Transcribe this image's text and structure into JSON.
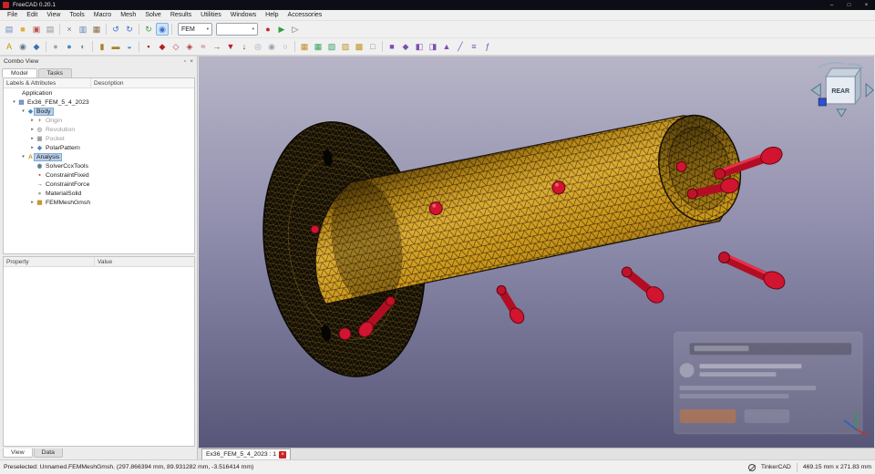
{
  "window": {
    "title": "FreeCAD 0.20.1",
    "minimize": "–",
    "maximize": "□",
    "close": "×"
  },
  "menu_bar": {
    "items": [
      "File",
      "Edit",
      "View",
      "Tools",
      "Macro",
      "Mesh",
      "Solve",
      "Results",
      "Utilities",
      "Windows",
      "Help",
      "Accessories"
    ]
  },
  "toolbars": {
    "workbench_selector": "FEM",
    "macro_selector": "",
    "caret": "▾",
    "row1a": [
      {
        "name": "file-new-icon",
        "glyph": "▤",
        "color": "#6a8cbf",
        "cls": "",
        "inter": "true"
      },
      {
        "name": "file-open-icon",
        "glyph": "■",
        "color": "#e2af3a",
        "cls": "",
        "inter": "true"
      },
      {
        "name": "file-save-icon",
        "glyph": "▣",
        "color": "#c05050",
        "cls": "",
        "inter": "true"
      },
      {
        "name": "print-icon",
        "glyph": "▤",
        "color": "#8a8f99",
        "cls": "",
        "inter": "true"
      },
      {
        "name": "toolbar-separator",
        "glyph": "",
        "color": "",
        "cls": "sep",
        "inter": "false"
      },
      {
        "name": "cut-icon",
        "glyph": "×",
        "color": "#6a7c8e",
        "cls": "",
        "inter": "true"
      },
      {
        "name": "copy-icon",
        "glyph": "▥",
        "color": "#5b82b5",
        "cls": "",
        "inter": "true"
      },
      {
        "name": "paste-icon",
        "glyph": "▦",
        "color": "#8a6a4a",
        "cls": "",
        "inter": "true"
      },
      {
        "name": "toolbar-separator",
        "glyph": "",
        "color": "",
        "cls": "sep",
        "inter": "false"
      },
      {
        "name": "undo-icon",
        "glyph": "↺",
        "color": "#3a6fc0",
        "cls": "",
        "inter": "true"
      },
      {
        "name": "redo-icon",
        "glyph": "↻",
        "color": "#3a6fc0",
        "cls": "",
        "inter": "true"
      },
      {
        "name": "toolbar-separator",
        "glyph": "",
        "color": "",
        "cls": "sep",
        "inter": "false"
      },
      {
        "name": "refresh-icon",
        "glyph": "↻",
        "color": "#3fa040",
        "cls": "",
        "inter": "true"
      },
      {
        "name": "box-zoom-icon",
        "glyph": "◉",
        "color": "#3a6fc0",
        "cls": "active",
        "inter": "true"
      },
      {
        "name": "toolbar-separator",
        "glyph": "",
        "color": "",
        "cls": "sep",
        "inter": "false"
      }
    ],
    "row1b": [
      {
        "name": "macro-record-icon",
        "glyph": "●",
        "color": "#cc2020",
        "cls": "",
        "inter": "true"
      },
      {
        "name": "macro-play-icon",
        "glyph": "▶",
        "color": "#2f9e44",
        "cls": "",
        "inter": "true"
      },
      {
        "name": "macro-debug-icon",
        "glyph": "▷",
        "color": "#5a6b7c",
        "cls": "",
        "inter": "true"
      }
    ],
    "row2": [
      {
        "name": "fem-analysis-icon",
        "glyph": "A",
        "color": "#c8900f",
        "cls": "",
        "inter": "true"
      },
      {
        "name": "fem-solver-ccxtools-icon",
        "glyph": "◉",
        "color": "#5b7a93",
        "cls": "",
        "inter": "true"
      },
      {
        "name": "fem-solver-elmer-icon",
        "glyph": "◆",
        "color": "#3f6fae",
        "cls": "",
        "inter": "true"
      },
      {
        "name": "toolbar-separator",
        "glyph": "",
        "color": "",
        "cls": "sep",
        "inter": "false"
      },
      {
        "name": "fem-material-solid-icon",
        "glyph": "●",
        "color": "#98a6b4",
        "cls": "",
        "inter": "true"
      },
      {
        "name": "fem-material-fluid-icon",
        "glyph": "●",
        "color": "#3f87c0",
        "cls": "",
        "inter": "true"
      },
      {
        "name": "fem-material-editor-icon",
        "glyph": "◐",
        "color": "#7a8a98",
        "cls": "",
        "inter": "true"
      },
      {
        "name": "toolbar-separator",
        "glyph": "",
        "color": "",
        "cls": "sep",
        "inter": "false"
      },
      {
        "name": "fem-beam-section-icon",
        "glyph": "▮",
        "color": "#a97f2f",
        "cls": "",
        "inter": "true"
      },
      {
        "name": "fem-shell-thickness-icon",
        "glyph": "▬",
        "color": "#a97f2f",
        "cls": "",
        "inter": "true"
      },
      {
        "name": "fem-fluid-section-icon",
        "glyph": "◒",
        "color": "#3f87c0",
        "cls": "",
        "inter": "true"
      },
      {
        "name": "toolbar-separator",
        "glyph": "",
        "color": "",
        "cls": "sep",
        "inter": "false"
      },
      {
        "name": "fem-constraint-fixed-icon",
        "glyph": "▪",
        "color": "#b02020",
        "cls": "",
        "inter": "true"
      },
      {
        "name": "fem-constraint-displacement-icon",
        "glyph": "◆",
        "color": "#b02020",
        "cls": "",
        "inter": "true"
      },
      {
        "name": "fem-constraint-contact-icon",
        "glyph": "◇",
        "color": "#b04040",
        "cls": "",
        "inter": "true"
      },
      {
        "name": "fem-constraint-tie-icon",
        "glyph": "◈",
        "color": "#b04040",
        "cls": "",
        "inter": "true"
      },
      {
        "name": "fem-constraint-spring-icon",
        "glyph": "≈",
        "color": "#b05050",
        "cls": "",
        "inter": "true"
      },
      {
        "name": "fem-constraint-force-icon",
        "glyph": "→",
        "color": "#c01828",
        "cls": "",
        "inter": "true"
      },
      {
        "name": "fem-constraint-pressure-icon",
        "glyph": "▼",
        "color": "#c01828",
        "cls": "",
        "inter": "true"
      },
      {
        "name": "fem-constraint-self-weight-icon",
        "glyph": "↓",
        "color": "#c01828",
        "cls": "",
        "inter": "true"
      },
      {
        "name": "fem-constraint-bearing-icon",
        "glyph": "◎",
        "color": "#98a6b4",
        "cls": "",
        "inter": "true"
      },
      {
        "name": "fem-constraint-gear-icon",
        "glyph": "◉",
        "color": "#98a6b4",
        "cls": "",
        "inter": "true"
      },
      {
        "name": "fem-constraint-pulley-icon",
        "glyph": "○",
        "color": "#98a6b4",
        "cls": "",
        "inter": "true"
      },
      {
        "name": "toolbar-separator",
        "glyph": "",
        "color": "",
        "cls": "sep",
        "inter": "false"
      },
      {
        "name": "fem-mesh-gmsh-icon",
        "glyph": "▦",
        "color": "#c09020",
        "cls": "",
        "inter": "true"
      },
      {
        "name": "fem-mesh-netgen-icon",
        "glyph": "▦",
        "color": "#3aa060",
        "cls": "",
        "inter": "true"
      },
      {
        "name": "fem-mesh-boundary-layer-icon",
        "glyph": "▧",
        "color": "#3aa060",
        "cls": "",
        "inter": "true"
      },
      {
        "name": "fem-mesh-region-icon",
        "glyph": "▨",
        "color": "#c09020",
        "cls": "",
        "inter": "true"
      },
      {
        "name": "fem-mesh-group-icon",
        "glyph": "▩",
        "color": "#c09020",
        "cls": "",
        "inter": "true"
      },
      {
        "name": "fem-mesh-clear-icon",
        "glyph": "□",
        "color": "#888888",
        "cls": "",
        "inter": "true"
      },
      {
        "name": "toolbar-separator",
        "glyph": "",
        "color": "",
        "cls": "sep",
        "inter": "false"
      },
      {
        "name": "fem-post-pipeline-icon",
        "glyph": "■",
        "color": "#7d4fb0",
        "cls": "",
        "inter": "true"
      },
      {
        "name": "fem-post-warp-icon",
        "glyph": "◆",
        "color": "#7d4fb0",
        "cls": "",
        "inter": "true"
      },
      {
        "name": "fem-post-clip-icon",
        "glyph": "◧",
        "color": "#7d4fb0",
        "cls": "",
        "inter": "true"
      },
      {
        "name": "fem-post-scalar-clip-icon",
        "glyph": "◨",
        "color": "#7d4fb0",
        "cls": "",
        "inter": "true"
      },
      {
        "name": "fem-post-cut-function-icon",
        "glyph": "▲",
        "color": "#7d4fb0",
        "cls": "",
        "inter": "true"
      },
      {
        "name": "fem-post-data-along-line-icon",
        "glyph": "╱",
        "color": "#7d4fb0",
        "cls": "",
        "inter": "true"
      },
      {
        "name": "fem-post-linearized-stress-icon",
        "glyph": "≡",
        "color": "#7d4fb0",
        "cls": "",
        "inter": "true"
      },
      {
        "name": "fem-post-filter-functions-icon",
        "glyph": "ƒ",
        "color": "#7d4fb0",
        "cls": "",
        "inter": "true"
      }
    ]
  },
  "combo_view": {
    "title": "Combo View",
    "float_btn": "▫",
    "close_btn": "×",
    "tabs": [
      "Model",
      "Tasks"
    ],
    "tree_header": [
      "Labels & Attributes",
      "Description"
    ],
    "tree": [
      {
        "label": "Application",
        "cls": "ind-0",
        "arrow": "",
        "icon_glyph": "",
        "icon_color": "",
        "icon_name": "",
        "inter": "true"
      },
      {
        "label": "Ex36_FEM_5_4_2023",
        "cls": "ind-1",
        "arrow": "▾",
        "icon_glyph": "▤",
        "icon_color": "#4a76b8",
        "icon_name": "document-icon",
        "inter": "true"
      },
      {
        "label": "Body",
        "cls": "ind-2 sel",
        "arrow": "▾",
        "icon_glyph": "◆",
        "icon_color": "#3f87c0",
        "icon_name": "body-icon",
        "inter": "true"
      },
      {
        "label": "Origin",
        "cls": "ind-3 dis",
        "arrow": "▸",
        "icon_glyph": "+",
        "icon_color": "#8a8a8a",
        "icon_name": "origin-icon",
        "inter": "true"
      },
      {
        "label": "Revolution",
        "cls": "ind-3 dis",
        "arrow": "▸",
        "icon_glyph": "◎",
        "icon_color": "#9a9a9a",
        "icon_name": "revolution-icon",
        "inter": "true"
      },
      {
        "label": "Pocket",
        "cls": "ind-3 dis",
        "arrow": "▸",
        "icon_glyph": "▣",
        "icon_color": "#9a9a9a",
        "icon_name": "pocket-icon",
        "inter": "true"
      },
      {
        "label": "PolarPattern",
        "cls": "ind-3",
        "arrow": "▸",
        "icon_glyph": "◈",
        "icon_color": "#4a76b8",
        "icon_name": "polar-pattern-icon",
        "inter": "true"
      },
      {
        "label": "Analysis",
        "cls": "ind-2 sel",
        "arrow": "▾",
        "icon_glyph": "A",
        "icon_color": "#c8900f",
        "icon_name": "analysis-icon",
        "inter": "true"
      },
      {
        "label": "SolverCcxTools",
        "cls": "ind-3",
        "arrow": "",
        "icon_glyph": "◉",
        "icon_color": "#5b7a93",
        "icon_name": "solver-icon",
        "inter": "true"
      },
      {
        "label": "ConstraintFixed",
        "cls": "ind-3",
        "arrow": "",
        "icon_glyph": "▪",
        "icon_color": "#b02020",
        "icon_name": "constraint-fixed-icon",
        "inter": "true"
      },
      {
        "label": "ConstraintForce",
        "cls": "ind-3",
        "arrow": "",
        "icon_glyph": "→",
        "icon_color": "#c01828",
        "icon_name": "constraint-force-icon",
        "inter": "true"
      },
      {
        "label": "MaterialSolid",
        "cls": "ind-3",
        "arrow": "",
        "icon_glyph": "●",
        "icon_color": "#97a5b2",
        "icon_name": "material-icon",
        "inter": "true"
      },
      {
        "label": "FEMMeshGmsh",
        "cls": "ind-3",
        "arrow": "▸",
        "icon_glyph": "▦",
        "icon_color": "#c09020",
        "icon_name": "mesh-icon",
        "inter": "true"
      }
    ],
    "property_header": [
      "Property",
      "Value"
    ],
    "bottom_tabs": [
      "View",
      "Data"
    ]
  },
  "viewport": {
    "nav_cube_face": "REAR",
    "file_tab": {
      "label": "Ex36_FEM_5_4_2023 : 1",
      "close": "×"
    }
  },
  "status_bar": {
    "message": "Preselected: Unnamed.FEMMeshGmsh. (297.866394 mm, 89.931282 mm, -3.516414 mm)",
    "nav_style": "TinkerCAD",
    "dimensions": "469.15 mm x 271.83 mm"
  }
}
